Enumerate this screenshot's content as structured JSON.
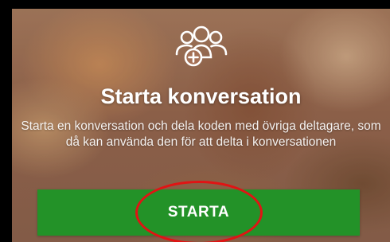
{
  "header": {
    "icon": "people-add-icon",
    "title": "Starta konversation"
  },
  "description": "Starta en konversation och dela koden med övriga deltagare, som då kan använda den för att delta i konversationen",
  "actions": {
    "start_label": "STARTA"
  },
  "colors": {
    "button_green": "#239228",
    "highlight_red": "#e01414",
    "text": "#ffffff"
  }
}
